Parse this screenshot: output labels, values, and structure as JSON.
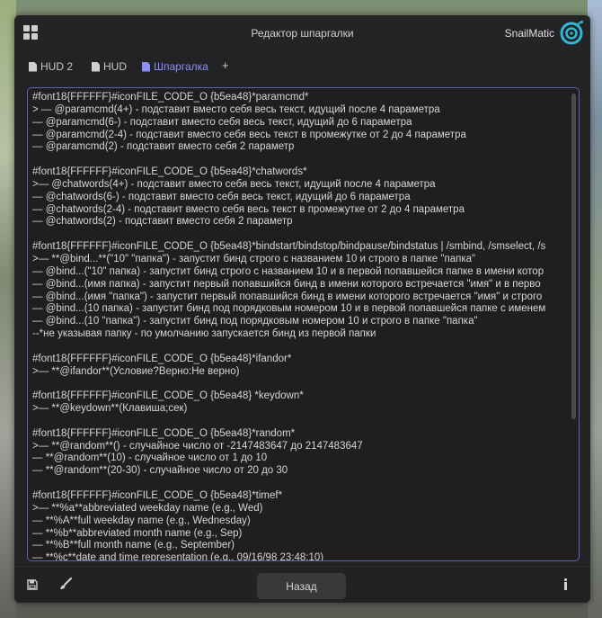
{
  "window": {
    "title": "Редактор шпаргалки",
    "brand": "SnailMatic"
  },
  "tabs": [
    {
      "label": "HUD 2",
      "active": false
    },
    {
      "label": "HUD",
      "active": false
    },
    {
      "label": "Шпаргалка",
      "active": true
    }
  ],
  "tab_add_label": "+",
  "editor": {
    "lines": [
      "#font18{FFFFFF}#iconFILE_CODE_O {b5ea48}*paramcmd*",
      "> — @paramcmd(4+) - подставит вместо себя весь текст, идущий после 4 параметра",
      "— @paramcmd(6-) - подставит вместо себя весь текст, идущий до 6 параметра",
      "— @paramcmd(2-4) - подставит вместо себя весь текст в промежутке от 2 до 4 параметра",
      "— @paramcmd(2) - подставит вместо себя 2 параметр",
      "",
      "#font18{FFFFFF}#iconFILE_CODE_O {b5ea48}*chatwords*",
      ">— @chatwords(4+) - подставит вместо себя весь текст, идущий после 4 параметра",
      "— @chatwords(6-) - подставит вместо себя весь текст, идущий до 6 параметра",
      "— @chatwords(2-4) - подставит вместо себя весь текст в промежутке от 2 до 4 параметра",
      "— @chatwords(2) - подставит вместо себя 2 параметр",
      "",
      "#font18{FFFFFF}#iconFILE_CODE_O {b5ea48}*bindstart/bindstop/bindpause/bindstatus | /smbind, /smselect, /s",
      ">— **@bind...**(\"10\" \"папка\") - запустит бинд строго с названием 10 и строго в папке \"папка\"",
      "— @bind...(\"10\" папка) - запустит бинд строго с названием 10 и в первой попавшейся папке в имени котор",
      "— @bind...(имя папка) - запустит первый попавшийся бинд в имени которого встречается \"имя\" и в перво",
      "— @bind...(имя \"папка\") - запустит первый попавшийся бинд в имени которого встречается \"имя\" и строго",
      "— @bind...(10 папка) - запустит бинд под порядковым номером 10 и в первой попавшейся папке с именем",
      "— @bind...(10 \"папка\") - запустит бинд под порядковым номером 10 и строго в папке \"папка\"",
      "--*не указывая папку - по умолчанию запускается бинд из первой папки",
      "",
      "#font18{FFFFFF}#iconFILE_CODE_O {b5ea48}*ifandor*",
      ">— **@ifandor**(Условие?Верно:Не верно)",
      "",
      "#font18{FFFFFF}#iconFILE_CODE_O {b5ea48} *keydown*",
      ">— **@keydown**(Клавиша;сек)",
      "",
      "#font18{FFFFFF}#iconFILE_CODE_O {b5ea48}*random*",
      ">— **@random**() - случайное число от -2147483647 до 2147483647",
      "— **@random**(10) - случайное число от 1 до 10",
      "— **@random**(20-30) - случайное число от 20 до 30",
      "",
      "#font18{FFFFFF}#iconFILE_CODE_O {b5ea48}*timef*",
      ">— **%a**abbreviated weekday name (e.g., Wed)",
      "— **%A**full weekday name (e.g., Wednesday)",
      "— **%b**abbreviated month name (e.g., Sep)",
      "— **%B**full month name (e.g., September)",
      "— **%c**date and time representation (e.g., 09/16/98 23:48:10)"
    ]
  },
  "footer": {
    "back_label": "Назад"
  },
  "icons": {
    "menu": "grid-icon",
    "logo": "snail-logo-icon",
    "tab": "document-icon",
    "save": "save-icon",
    "brush": "brush-icon",
    "info": "info-icon"
  },
  "colors": {
    "accent": "#8b8ff5",
    "editor_border": "#5c62b8",
    "logo": "#2fb8d8"
  }
}
